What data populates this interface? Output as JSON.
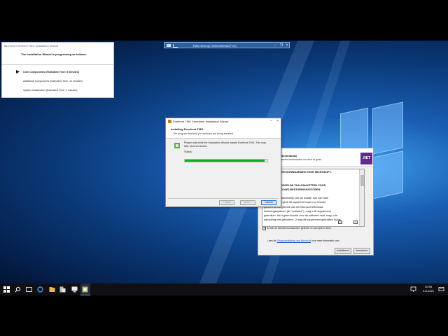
{
  "rdp_bar": {
    "title": "TMG-test op HOSAWIN10T-VC"
  },
  "progress_window": {
    "header": "Microsoft Forefront TMG Installation Wizard",
    "heading": "The Installation Wizard is progressing as follows:",
    "steps": [
      {
        "label": "Core Components (Estimated Time: 5 minutes)",
        "current": true
      },
      {
        "label": "Additional Components (Estimated Time: 12 minutes)",
        "current": false
      },
      {
        "label": "System Initialization (Estimated Time: 2 minutes)",
        "current": false
      }
    ]
  },
  "net_window": {
    "title": "(Nederlands)",
    "subtitle": "licentievoorwaarden om door te gaan.",
    "logo_text": ".NET",
    "license_lines": [
      {
        "text": "ENDE LICENTIEVOORWAARDEN VOOR MICROSOFT-",
        "bold": true
      },
      {
        "text": "RE",
        "bold": true
      },
      {
        "text": "",
        "bold": false
      },
      {
        "text": "ORK EN GEKOPPELDE TAALPAKKETTEN VOOR",
        "bold": true
      },
      {
        "text": "ROSOFT WINDOWS-BESTURINGSSYSTEEM",
        "bold": true
      },
      {
        "text": "",
        "bold": false
      },
      {
        "text": "orporation (of, afhankelijk van uw locatie, een van haar",
        "bold": false
      },
      {
        "text": "ndernemingen) geeft dit supplement aan u in licentie.",
        "bold": false
      },
      {
        "text": "gd bent tot het gebruik van het Microsoft Windows-",
        "bold": false
      },
      {
        "text": "besturingssysteem (de \"software\"), mag u dit supplement",
        "bold": false
      },
      {
        "text": "gebruiken. Als u geen licentie voor de software hebt, mag u de",
        "bold": false
      },
      {
        "text": "aanvulling niet gebruiken. U mag dit supplement gebruiken bij elk",
        "bold": false
      }
    ],
    "agree_label": "Ik heb de licentievoorwaarden gelezen en accepteer deze.",
    "privacy_prefix": "Lees de",
    "privacy_link": "Privacyverklaring van Microsoft",
    "privacy_suffix": "voor meer informatie over",
    "install_button": "Installeren",
    "cancel_button": "Annuleren"
  },
  "tmg_window": {
    "title": "Forefront TMG Enterprise Installation Wizard",
    "heading": "Installing Forefront TMG",
    "subheading": "The program features you selected are being installed.",
    "message": "Please wait while the Installation Wizard installs Forefront TMG. This may take several minutes.",
    "status_label": "Status:",
    "progress": 0.97,
    "back_button": "< Back",
    "next_button": "Next >",
    "cancel_button": "Cancel"
  },
  "taskbar": {
    "time": "20:58",
    "date": "2-8-2021"
  },
  "colors": {
    "progress_green": "#06b025",
    "net_purple": "#5c2d91",
    "taskbar": "#101014"
  }
}
